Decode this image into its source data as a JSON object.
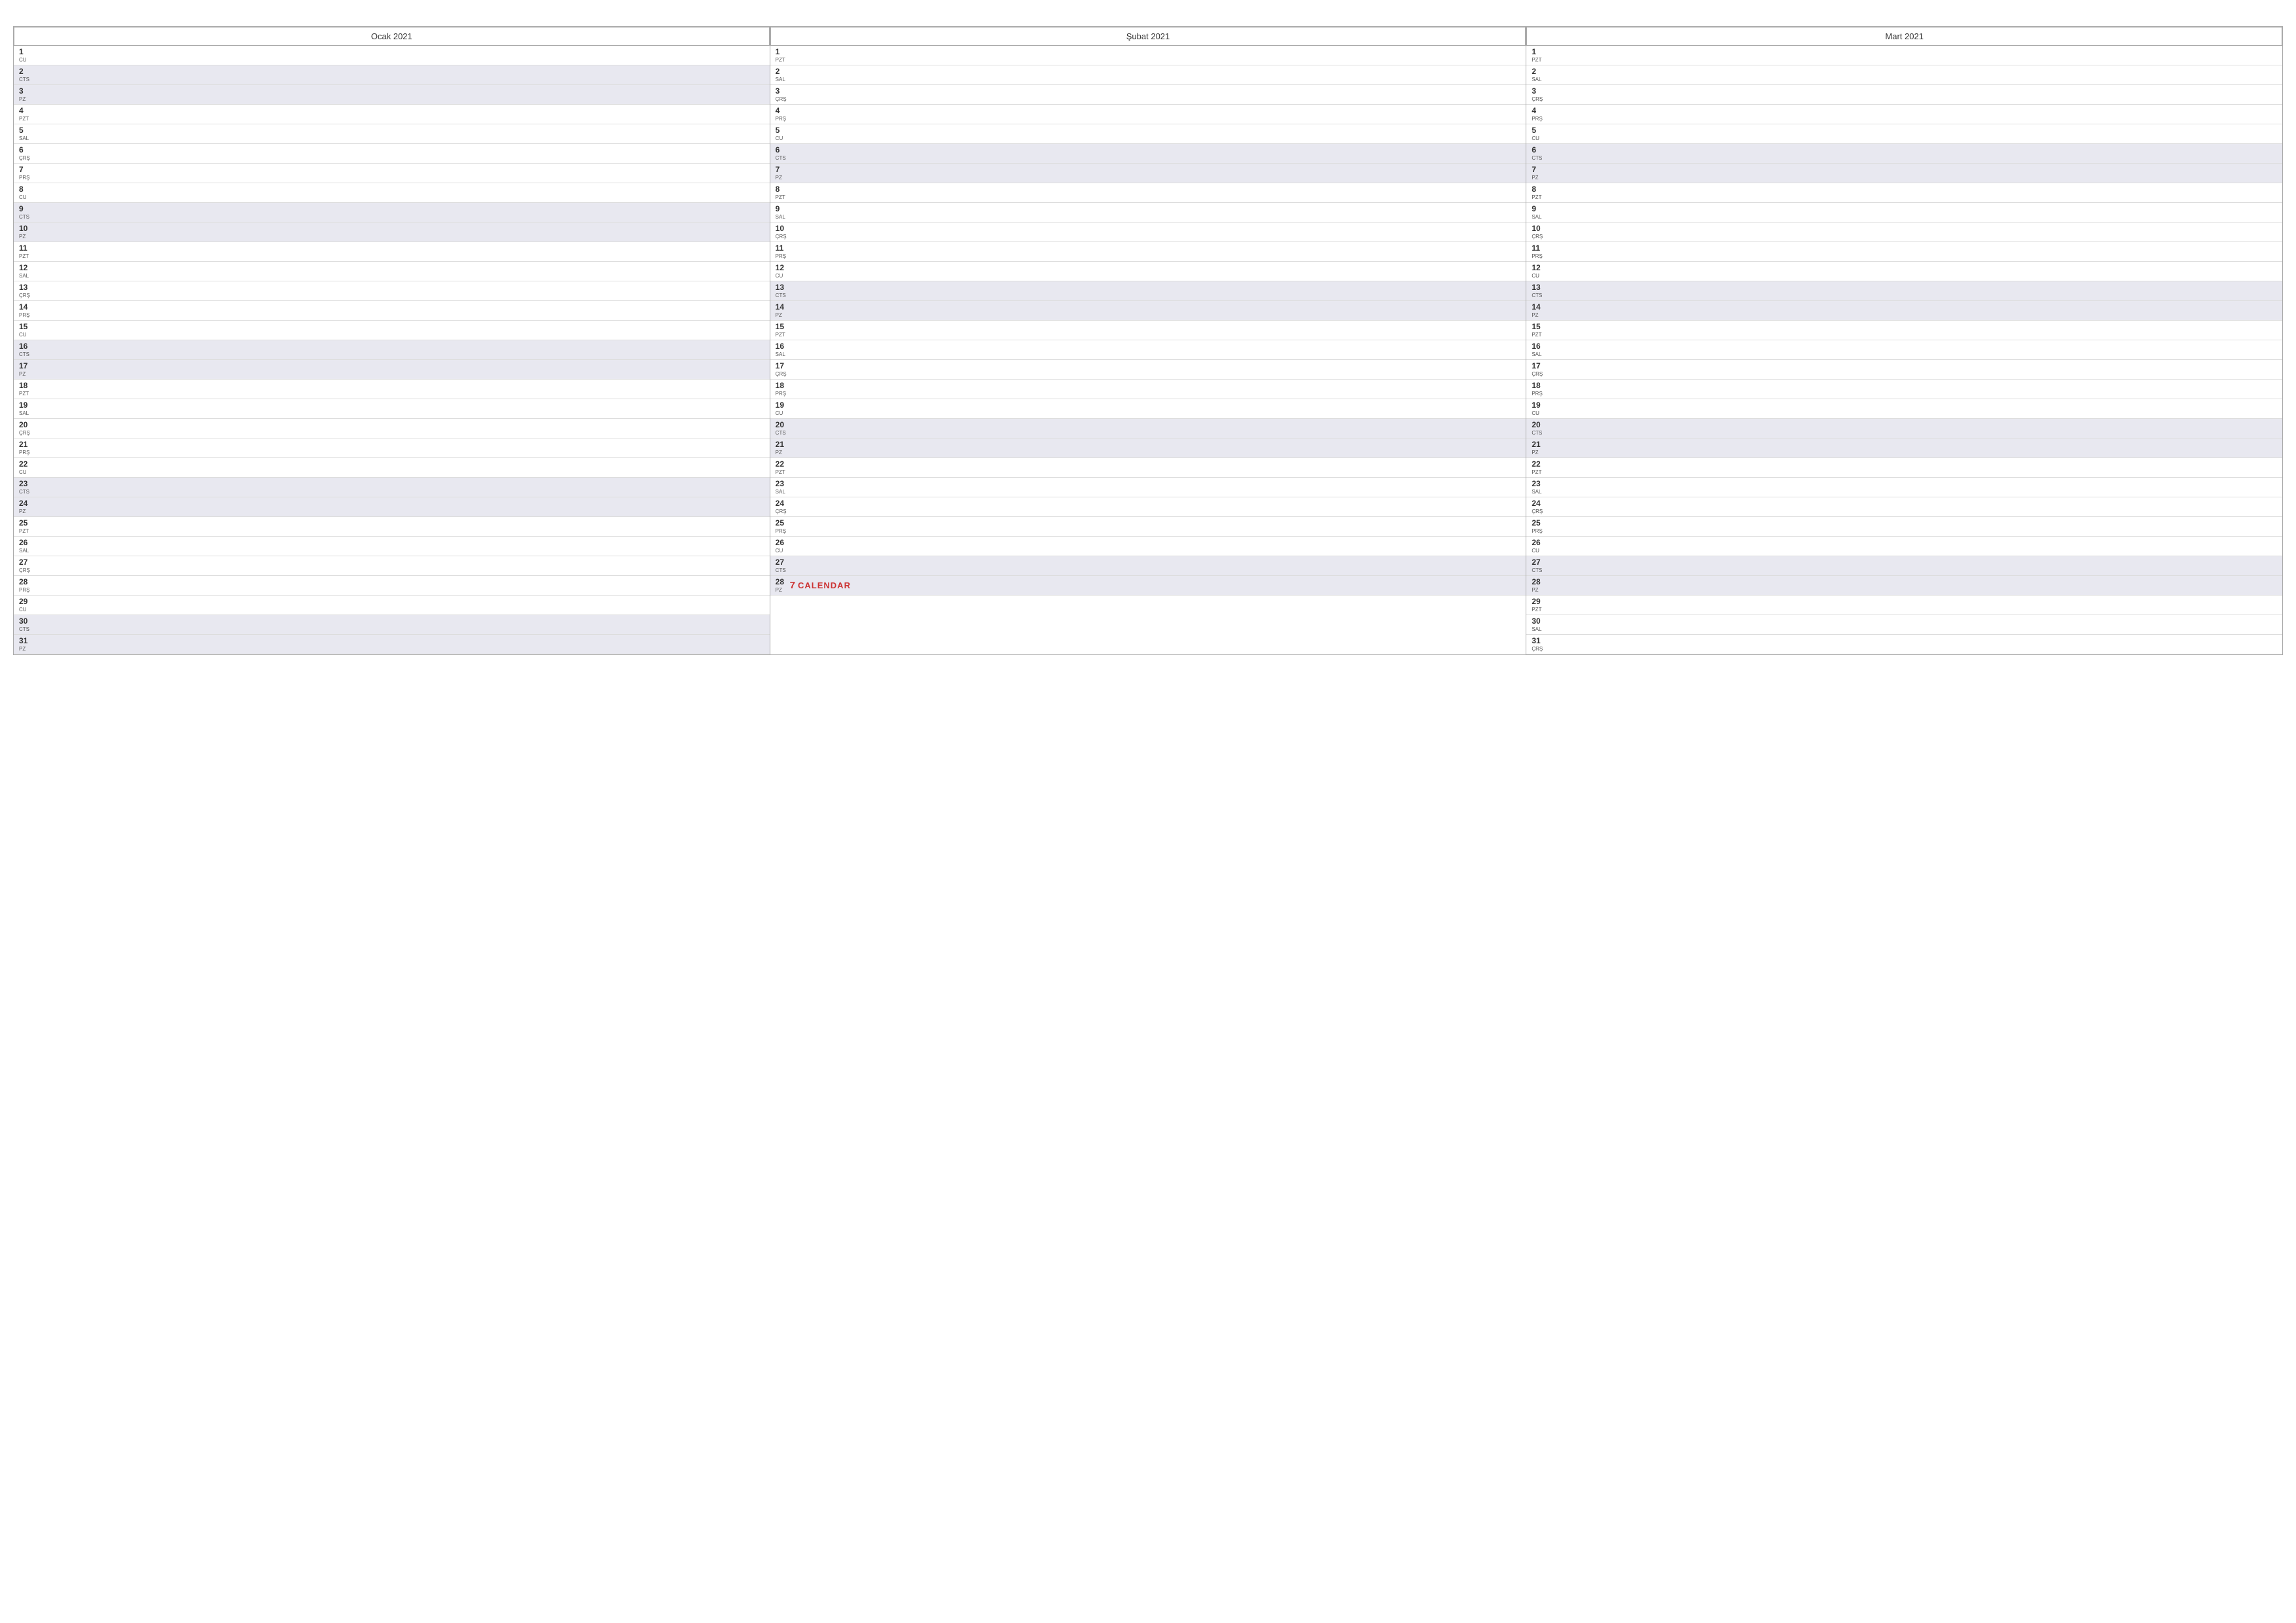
{
  "months": [
    {
      "name": "Ocak 2021",
      "days": [
        {
          "num": 1,
          "name": "CU",
          "weekend": false
        },
        {
          "num": 2,
          "name": "CTS",
          "weekend": true
        },
        {
          "num": 3,
          "name": "PZ",
          "weekend": true
        },
        {
          "num": 4,
          "name": "PZT",
          "weekend": false
        },
        {
          "num": 5,
          "name": "SAL",
          "weekend": false
        },
        {
          "num": 6,
          "name": "ÇRŞ",
          "weekend": false
        },
        {
          "num": 7,
          "name": "PRŞ",
          "weekend": false
        },
        {
          "num": 8,
          "name": "CU",
          "weekend": false
        },
        {
          "num": 9,
          "name": "CTS",
          "weekend": true
        },
        {
          "num": 10,
          "name": "PZ",
          "weekend": true
        },
        {
          "num": 11,
          "name": "PZT",
          "weekend": false
        },
        {
          "num": 12,
          "name": "SAL",
          "weekend": false
        },
        {
          "num": 13,
          "name": "ÇRŞ",
          "weekend": false
        },
        {
          "num": 14,
          "name": "PRŞ",
          "weekend": false
        },
        {
          "num": 15,
          "name": "CU",
          "weekend": false
        },
        {
          "num": 16,
          "name": "CTS",
          "weekend": true
        },
        {
          "num": 17,
          "name": "PZ",
          "weekend": true
        },
        {
          "num": 18,
          "name": "PZT",
          "weekend": false
        },
        {
          "num": 19,
          "name": "SAL",
          "weekend": false
        },
        {
          "num": 20,
          "name": "ÇRŞ",
          "weekend": false
        },
        {
          "num": 21,
          "name": "PRŞ",
          "weekend": false
        },
        {
          "num": 22,
          "name": "CU",
          "weekend": false
        },
        {
          "num": 23,
          "name": "CTS",
          "weekend": true
        },
        {
          "num": 24,
          "name": "PZ",
          "weekend": true
        },
        {
          "num": 25,
          "name": "PZT",
          "weekend": false
        },
        {
          "num": 26,
          "name": "SAL",
          "weekend": false
        },
        {
          "num": 27,
          "name": "ÇRŞ",
          "weekend": false
        },
        {
          "num": 28,
          "name": "PRŞ",
          "weekend": false
        },
        {
          "num": 29,
          "name": "CU",
          "weekend": false
        },
        {
          "num": 30,
          "name": "CTS",
          "weekend": true
        },
        {
          "num": 31,
          "name": "PZ",
          "weekend": true
        }
      ]
    },
    {
      "name": "Şubat 2021",
      "days": [
        {
          "num": 1,
          "name": "PZT",
          "weekend": false
        },
        {
          "num": 2,
          "name": "SAL",
          "weekend": false
        },
        {
          "num": 3,
          "name": "ÇRŞ",
          "weekend": false
        },
        {
          "num": 4,
          "name": "PRŞ",
          "weekend": false
        },
        {
          "num": 5,
          "name": "CU",
          "weekend": false
        },
        {
          "num": 6,
          "name": "CTS",
          "weekend": true
        },
        {
          "num": 7,
          "name": "PZ",
          "weekend": true
        },
        {
          "num": 8,
          "name": "PZT",
          "weekend": false
        },
        {
          "num": 9,
          "name": "SAL",
          "weekend": false
        },
        {
          "num": 10,
          "name": "ÇRŞ",
          "weekend": false
        },
        {
          "num": 11,
          "name": "PRŞ",
          "weekend": false
        },
        {
          "num": 12,
          "name": "CU",
          "weekend": false
        },
        {
          "num": 13,
          "name": "CTS",
          "weekend": true
        },
        {
          "num": 14,
          "name": "PZ",
          "weekend": true
        },
        {
          "num": 15,
          "name": "PZT",
          "weekend": false
        },
        {
          "num": 16,
          "name": "SAL",
          "weekend": false
        },
        {
          "num": 17,
          "name": "ÇRŞ",
          "weekend": false
        },
        {
          "num": 18,
          "name": "PRŞ",
          "weekend": false
        },
        {
          "num": 19,
          "name": "CU",
          "weekend": false
        },
        {
          "num": 20,
          "name": "CTS",
          "weekend": true
        },
        {
          "num": 21,
          "name": "PZ",
          "weekend": true
        },
        {
          "num": 22,
          "name": "PZT",
          "weekend": false
        },
        {
          "num": 23,
          "name": "SAL",
          "weekend": false
        },
        {
          "num": 24,
          "name": "ÇRŞ",
          "weekend": false
        },
        {
          "num": 25,
          "name": "PRŞ",
          "weekend": false
        },
        {
          "num": 26,
          "name": "CU",
          "weekend": false
        },
        {
          "num": 27,
          "name": "CTS",
          "weekend": true
        },
        {
          "num": 28,
          "name": "PZ",
          "weekend": true
        }
      ]
    },
    {
      "name": "Mart 2021",
      "days": [
        {
          "num": 1,
          "name": "PZT",
          "weekend": false
        },
        {
          "num": 2,
          "name": "SAL",
          "weekend": false
        },
        {
          "num": 3,
          "name": "ÇRŞ",
          "weekend": false
        },
        {
          "num": 4,
          "name": "PRŞ",
          "weekend": false
        },
        {
          "num": 5,
          "name": "CU",
          "weekend": false
        },
        {
          "num": 6,
          "name": "CTS",
          "weekend": true
        },
        {
          "num": 7,
          "name": "PZ",
          "weekend": true
        },
        {
          "num": 8,
          "name": "PZT",
          "weekend": false
        },
        {
          "num": 9,
          "name": "SAL",
          "weekend": false
        },
        {
          "num": 10,
          "name": "ÇRŞ",
          "weekend": false
        },
        {
          "num": 11,
          "name": "PRŞ",
          "weekend": false
        },
        {
          "num": 12,
          "name": "CU",
          "weekend": false
        },
        {
          "num": 13,
          "name": "CTS",
          "weekend": true
        },
        {
          "num": 14,
          "name": "PZ",
          "weekend": true
        },
        {
          "num": 15,
          "name": "PZT",
          "weekend": false
        },
        {
          "num": 16,
          "name": "SAL",
          "weekend": false
        },
        {
          "num": 17,
          "name": "ÇRŞ",
          "weekend": false
        },
        {
          "num": 18,
          "name": "PRŞ",
          "weekend": false
        },
        {
          "num": 19,
          "name": "CU",
          "weekend": false
        },
        {
          "num": 20,
          "name": "CTS",
          "weekend": true
        },
        {
          "num": 21,
          "name": "PZ",
          "weekend": true
        },
        {
          "num": 22,
          "name": "PZT",
          "weekend": false
        },
        {
          "num": 23,
          "name": "SAL",
          "weekend": false
        },
        {
          "num": 24,
          "name": "ÇRŞ",
          "weekend": false
        },
        {
          "num": 25,
          "name": "PRŞ",
          "weekend": false
        },
        {
          "num": 26,
          "name": "CU",
          "weekend": false
        },
        {
          "num": 27,
          "name": "CTS",
          "weekend": true
        },
        {
          "num": 28,
          "name": "PZ",
          "weekend": true
        },
        {
          "num": 29,
          "name": "PZT",
          "weekend": false
        },
        {
          "num": 30,
          "name": "SAL",
          "weekend": false
        },
        {
          "num": 31,
          "name": "ÇRŞ",
          "weekend": false
        }
      ]
    }
  ],
  "watermark": {
    "icon": "7",
    "text": "CALENDAR"
  }
}
